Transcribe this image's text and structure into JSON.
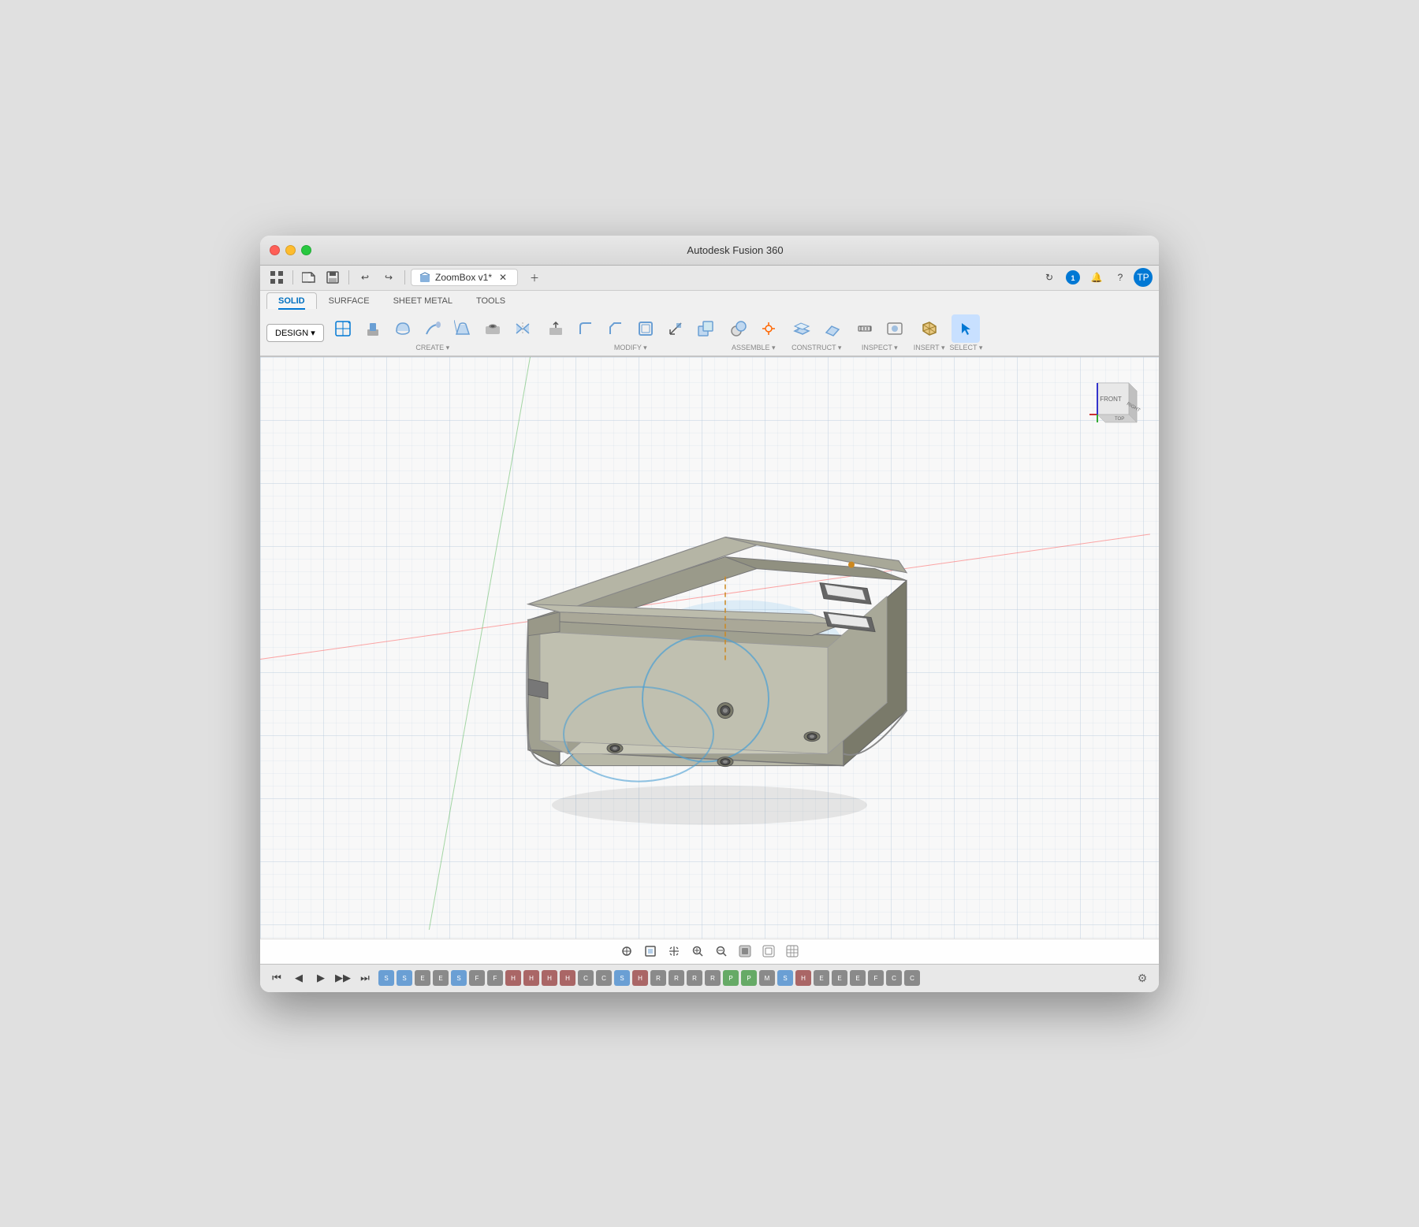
{
  "window": {
    "title": "Autodesk Fusion 360",
    "tab_title": "ZoomBox v1*"
  },
  "toolbar_row1": {
    "grid_icon": "⊞",
    "undo_label": "↩",
    "redo_label": "↪"
  },
  "tabs": [
    {
      "id": "solid",
      "label": "SOLID",
      "active": true
    },
    {
      "id": "surface",
      "label": "SURFACE",
      "active": false
    },
    {
      "id": "sheet_metal",
      "label": "SHEET METAL",
      "active": false
    },
    {
      "id": "tools",
      "label": "TOOLS",
      "active": false
    }
  ],
  "design_btn": "DESIGN ▾",
  "toolbar_groups": [
    {
      "id": "create",
      "label": "CREATE ▾",
      "buttons": [
        "new-sketch",
        "extrude",
        "revolve",
        "sweep",
        "loft",
        "hole",
        "mirror"
      ]
    },
    {
      "id": "modify",
      "label": "MODIFY ▾",
      "buttons": [
        "press-pull",
        "fillet",
        "chamfer",
        "shell",
        "scale",
        "combine"
      ]
    },
    {
      "id": "assemble",
      "label": "ASSEMBLE ▾",
      "buttons": [
        "joint",
        "joint-origin"
      ]
    },
    {
      "id": "construct",
      "label": "CONSTRUCT ▾",
      "buttons": [
        "offset-plane",
        "plane-at-angle"
      ]
    },
    {
      "id": "inspect",
      "label": "INSPECT ▾",
      "buttons": [
        "measure",
        "display-settings"
      ]
    },
    {
      "id": "insert",
      "label": "INSERT ▾",
      "buttons": [
        "insert-mesh"
      ]
    },
    {
      "id": "select",
      "label": "SELECT ▾",
      "buttons": [
        "select"
      ],
      "active": true
    }
  ],
  "nav_bottom": {
    "icons": [
      "⊕",
      "💾",
      "✋",
      "🔍",
      "🔍",
      "⊞",
      "⬛",
      "☰"
    ]
  },
  "timeline": {
    "controls": [
      "⏮",
      "◀",
      "▶",
      "▶▶",
      "⏭"
    ],
    "icons_count": 30
  },
  "model": {
    "description": "ZoomBox enclosure - open top box with mounting holes"
  },
  "colors": {
    "box_fill": "#8a8a7a",
    "box_inner": "#a0a090",
    "box_bottom": "#b0b0a0",
    "highlight_circle": "rgba(100,180,220,0.3)",
    "selection_blue": "#4a9fd4",
    "accent": "#0078d4",
    "grid_line": "rgba(180,200,220,0.3)"
  }
}
